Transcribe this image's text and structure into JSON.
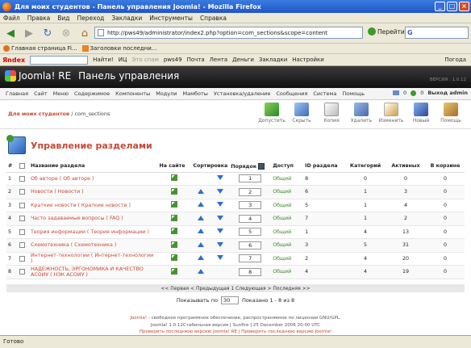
{
  "window": {
    "title": "Для моих студентов - Панель управления Joomla! - Mozilla Firefox"
  },
  "menubar": [
    "Файл",
    "Правка",
    "Вид",
    "Переход",
    "Закладки",
    "Инструменты",
    "Справка"
  ],
  "navbar": {
    "url": "http://pws49/administrator/index2.php?option=com_sections&scope=content",
    "go_label": "Перейти"
  },
  "bookmarks": [
    "Главная страница Fi...",
    "Заголовки последни..."
  ],
  "yandexbar": {
    "logo": "Яndex",
    "find": "Найти!",
    "ic": "ИЦ",
    "spam": "Это спам",
    "pws": "pws49",
    "mail": "Почта",
    "feed": "Лента",
    "money": "Деньги",
    "bookmarks": "Закладки",
    "settings": "Настройки",
    "weather": "Погода"
  },
  "joomla": {
    "logo": "Joomla! RE",
    "panel": "Панель управления",
    "version": "ВЕРСИЯ : 1.0.12",
    "menu": [
      "Главная",
      "Сайт",
      "Меню",
      "Содержимое",
      "Компоненты",
      "Модули",
      "Мамботы",
      "Установка/удаление",
      "Сообщения",
      "Система",
      "Помощь"
    ],
    "counts": {
      "messages": "0",
      "users": "0"
    },
    "logout": "Выход admin",
    "breadcrumb": {
      "site": "Для моих студентов",
      "rest": " / com_sections"
    },
    "toolbar": [
      "Допустить",
      "Скрыть",
      "Копия",
      "Удалить",
      "Изменить",
      "Новый",
      "Помощь"
    ],
    "page_title": "Управление разделами"
  },
  "table": {
    "headers": {
      "num": "#",
      "name": "Название раздела",
      "published": "На сайте",
      "reorder": "Сортировка",
      "order": "Порядок",
      "access": "Доступ",
      "id": "ID раздела",
      "categories": "Категорий",
      "active": "Активных",
      "trash": "В корзине"
    },
    "rows": [
      {
        "num": "1",
        "name": "Об авторе ( Об авторе )",
        "order": "1",
        "access": "Общий",
        "id": "8",
        "categories": "0",
        "active": "0",
        "trash": "0"
      },
      {
        "num": "2",
        "name": "Новости ( Новости )",
        "order": "2",
        "access": "Общий",
        "id": "6",
        "categories": "1",
        "active": "3",
        "trash": "0"
      },
      {
        "num": "3",
        "name": "Краткие новости ( Краткие новости )",
        "order": "3",
        "access": "Общий",
        "id": "5",
        "categories": "1",
        "active": "4",
        "trash": "0"
      },
      {
        "num": "4",
        "name": "Часто задаваемые вопросы ( FAQ )",
        "order": "4",
        "access": "Общий",
        "id": "7",
        "categories": "1",
        "active": "2",
        "trash": "0"
      },
      {
        "num": "5",
        "name": "Теория информации ( Теория информации )",
        "order": "5",
        "access": "Общий",
        "id": "1",
        "categories": "4",
        "active": "13",
        "trash": "0"
      },
      {
        "num": "6",
        "name": "Схемотехника ( Схемотехника )",
        "order": "6",
        "access": "Общий",
        "id": "3",
        "categories": "5",
        "active": "31",
        "trash": "0"
      },
      {
        "num": "7",
        "name": "Интернет-технологии ( Интернет-технологии )",
        "order": "7",
        "access": "Общий",
        "id": "2",
        "categories": "4",
        "active": "20",
        "trash": "0"
      },
      {
        "num": "8",
        "name": "НАДЕЖНОСТЬ, ЭРГОНОМИКА И КАЧЕСТВО АСОИУ ( НЭК АСОИУ )",
        "order": "8",
        "access": "Общий",
        "id": "4",
        "categories": "4",
        "active": "19",
        "trash": "0"
      }
    ]
  },
  "pager": {
    "links": "<< Первая < Предыдущая 1 Следующая > Последняя >>",
    "show_label": "Показывать по",
    "per_page": "30",
    "shown": "Показано 1 - 8 из 8"
  },
  "footer": {
    "line1_link": "Joomla!",
    "line1_rest": " - свободное программное обеспечение, распространяемое по лицензии GNU/GPL.",
    "line2": "Joomla! 1.0.12Стабильная версия [ Sunfire ] 25 December 2006 20:00 UTC",
    "line3": "Проверить последнюю версию Joomla! RE | Проверить последнюю версию Joomla!"
  },
  "statusbar": "Готово"
}
